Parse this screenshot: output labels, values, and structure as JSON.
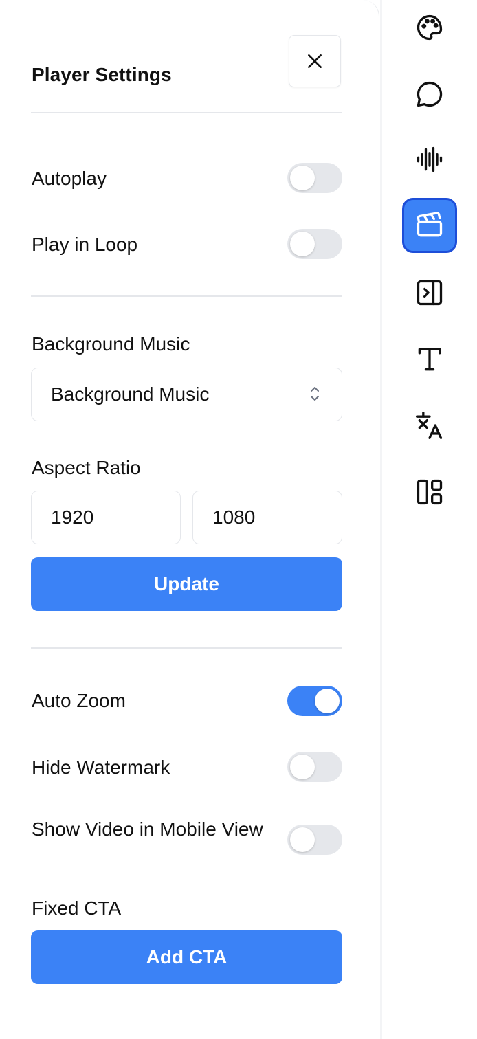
{
  "settings": {
    "title": "Player Settings",
    "autoplay": {
      "label": "Autoplay",
      "enabled": false
    },
    "play_in_loop": {
      "label": "Play in Loop",
      "enabled": false
    },
    "background_music": {
      "label": "Background Music",
      "selected": "Background Music"
    },
    "aspect_ratio": {
      "label": "Aspect Ratio",
      "width": "1920",
      "height": "1080",
      "update_label": "Update"
    },
    "auto_zoom": {
      "label": "Auto Zoom",
      "enabled": true
    },
    "hide_watermark": {
      "label": "Hide Watermark",
      "enabled": false
    },
    "show_video_mobile": {
      "label": "Show Video in Mobile View",
      "enabled": false
    },
    "fixed_cta": {
      "label": "Fixed CTA",
      "button_label": "Add CTA"
    }
  },
  "rail": {
    "items": [
      {
        "icon": "palette-icon",
        "active": false
      },
      {
        "icon": "chat-bubble-icon",
        "active": false
      },
      {
        "icon": "audio-waveform-icon",
        "active": false
      },
      {
        "icon": "clapperboard-icon",
        "active": true
      },
      {
        "icon": "panel-right-open-icon",
        "active": false
      },
      {
        "icon": "text-icon",
        "active": false
      },
      {
        "icon": "translate-icon",
        "active": false
      },
      {
        "icon": "layout-dashboard-icon",
        "active": false
      }
    ]
  },
  "colors": {
    "accent": "#3b82f6",
    "accent_border": "#1d4ed8",
    "toggle_off": "#e5e7eb",
    "border": "#e5e7eb",
    "text": "#111111"
  }
}
